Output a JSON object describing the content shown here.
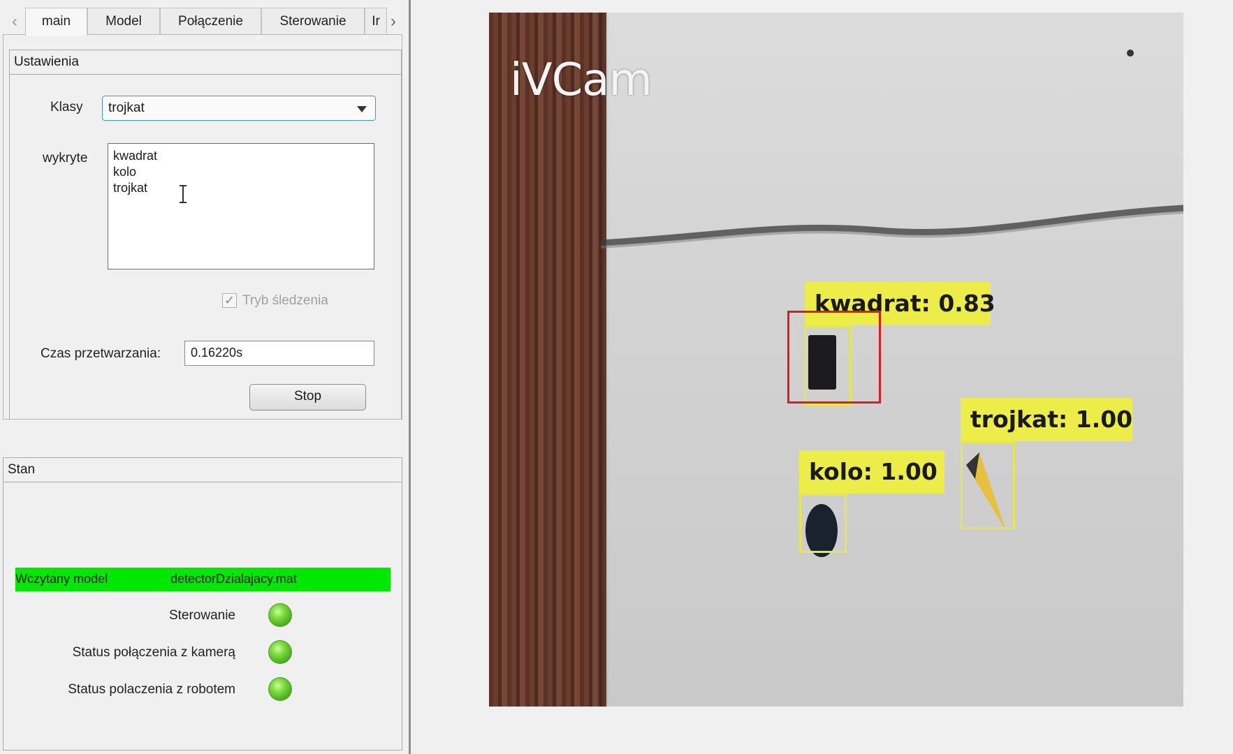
{
  "tabs": {
    "items": [
      "main",
      "Model",
      "Połączenie",
      "Sterowanie",
      "Ir"
    ],
    "active": "main"
  },
  "settings": {
    "title": "Ustawienia",
    "classes_label": "Klasy",
    "classes_value": "trojkat",
    "detected_label": "wykryte",
    "detected_items": [
      "kwadrat",
      "kolo",
      "trojkat"
    ],
    "tracking_label": "Tryb śledzenia",
    "tracking_checked": true,
    "processing_label": "Czas przetwarzania:",
    "processing_value": "0.16220s",
    "stop_label": "Stop"
  },
  "status": {
    "title": "Stan",
    "model_label": "Wczytany model",
    "model_value": "detectorDzialajacy.mat",
    "model_color": "#00e800",
    "rows": [
      {
        "label": "Sterowanie",
        "color": "#4fbf24"
      },
      {
        "label": "Status połączenia z kamerą",
        "color": "#4fbf24"
      },
      {
        "label": "Status polaczenia z robotem",
        "color": "#4fbf24"
      }
    ]
  },
  "camera": {
    "watermark": "iVCam",
    "detections": [
      {
        "label": "kwadrat: 0.83",
        "selected": true
      },
      {
        "label": "trojkat: 1.00",
        "selected": false
      },
      {
        "label": "kolo: 1.00",
        "selected": false
      }
    ],
    "label_color": "#eded4a",
    "selected_color": "#e01a1a"
  }
}
